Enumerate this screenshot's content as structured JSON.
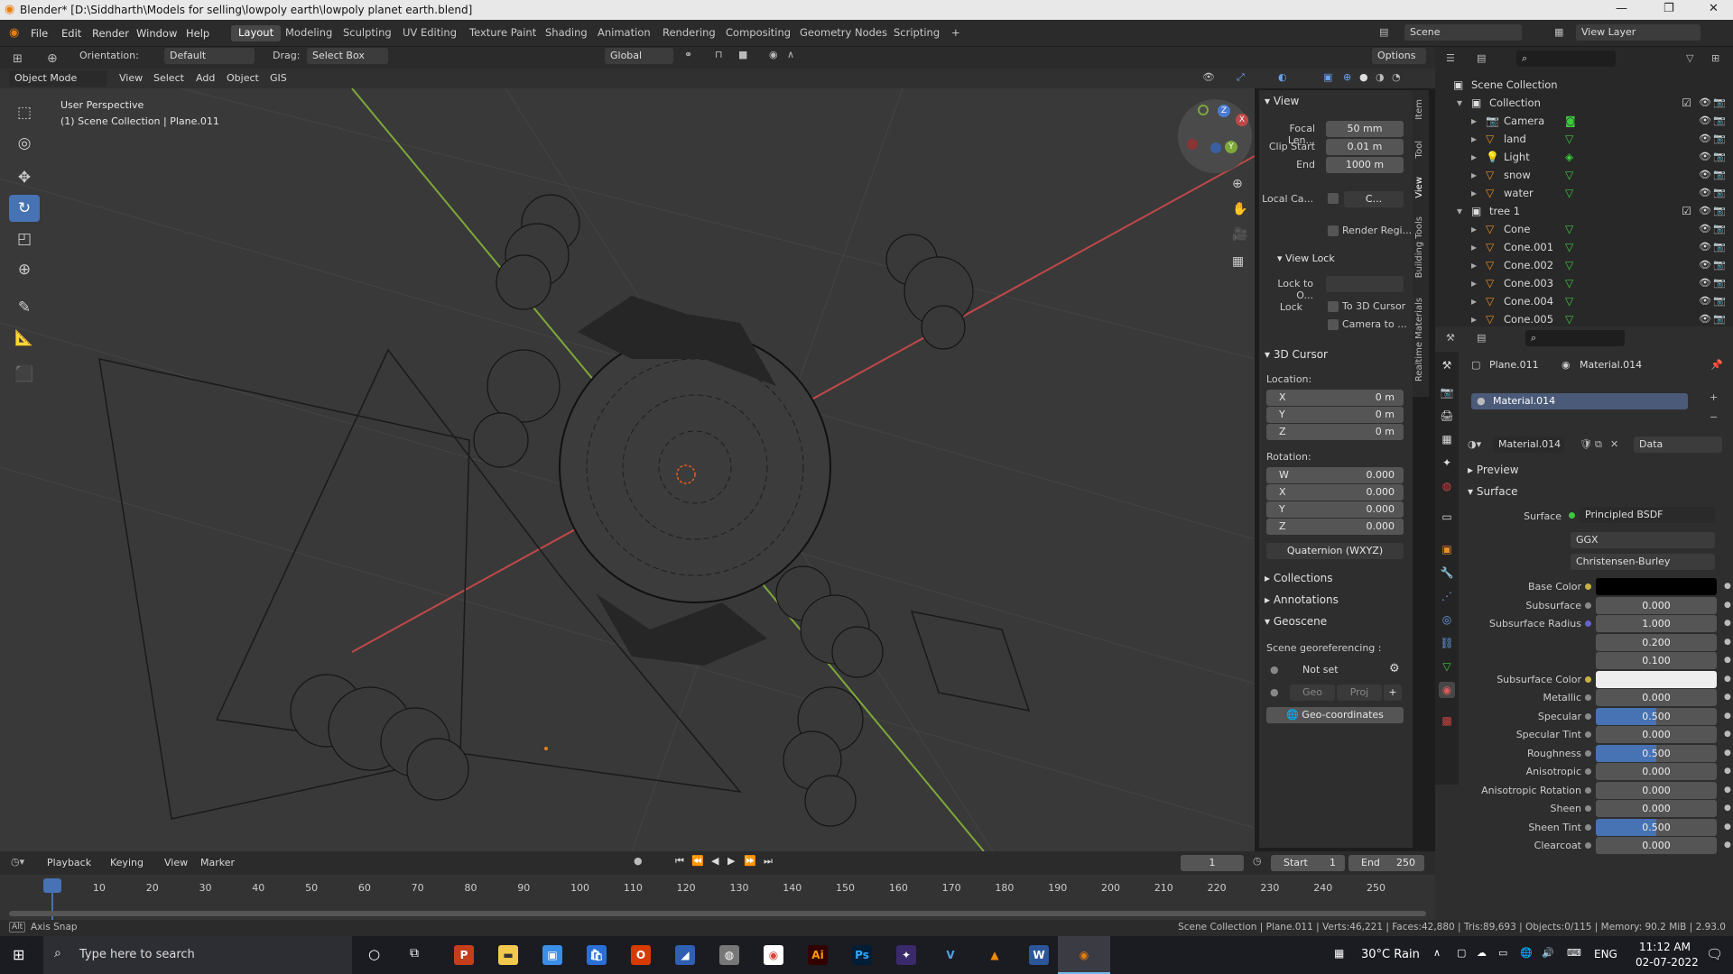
{
  "window": {
    "title": "Blender* [D:\\Siddharth\\Models for selling\\lowpoly earth\\lowpoly planet earth.blend]"
  },
  "menus": [
    "File",
    "Edit",
    "Render",
    "Window",
    "Help"
  ],
  "workspaces": [
    "Layout",
    "Modeling",
    "Sculpting",
    "UV Editing",
    "Texture Paint",
    "Shading",
    "Animation",
    "Rendering",
    "Compositing",
    "Geometry Nodes",
    "Scripting"
  ],
  "scene": {
    "name": "Scene",
    "view_layer": "View Layer"
  },
  "header3d": {
    "orientation_label": "Orientation:",
    "orientation_value": "Default",
    "drag_label": "Drag:",
    "drag_value": "Select Box",
    "transform": "Global",
    "options": "Options"
  },
  "subheader": {
    "mode": "Object Mode",
    "items": [
      "View",
      "Select",
      "Add",
      "Object",
      "GIS"
    ]
  },
  "viewport": {
    "perspective": "User Perspective",
    "collection_info": "(1) Scene Collection | Plane.011"
  },
  "npanel": {
    "tabs": [
      "Item",
      "Tool",
      "View",
      "Building Tools",
      "Realtime Materials"
    ],
    "view_section": "View",
    "focal_label": "Focal Len...",
    "focal_value": "50 mm",
    "clip_start_label": "Clip Start",
    "clip_start_value": "0.01 m",
    "end_label": "End",
    "end_value": "1000 m",
    "local_cam_label": "Local Ca...",
    "local_cam_value": "C...",
    "render_region": "Render Regi...",
    "view_lock": "View Lock",
    "lock_to_label": "Lock to O...",
    "lock_label": "Lock",
    "to_3d_cursor": "To 3D Cursor",
    "camera_to": "Camera to ...",
    "cursor_section": "3D Cursor",
    "location_label": "Location:",
    "loc_x": "0 m",
    "loc_y": "0 m",
    "loc_z": "0 m",
    "rotation_label": "Rotation:",
    "rot_w": "0.000",
    "rot_x": "0.000",
    "rot_y": "0.000",
    "rot_z": "0.000",
    "rotation_mode": "Quaternion (WXYZ)",
    "collections": "Collections",
    "annotations": "Annotations",
    "geoscene": "Geoscene",
    "georef_label": "Scene georeferencing :",
    "not_set": "Not set",
    "geo_btn": "Geo",
    "proj_btn": "Proj",
    "geo_coords": "Geo-coordinates"
  },
  "outliner": {
    "root": "Scene Collection",
    "rows": [
      {
        "name": "Collection",
        "indent": 0,
        "kind": "collection"
      },
      {
        "name": "Camera",
        "indent": 1,
        "kind": "camera"
      },
      {
        "name": "land",
        "indent": 1,
        "kind": "mesh"
      },
      {
        "name": "Light",
        "indent": 1,
        "kind": "light"
      },
      {
        "name": "snow",
        "indent": 1,
        "kind": "mesh"
      },
      {
        "name": "water",
        "indent": 1,
        "kind": "mesh"
      },
      {
        "name": "tree 1",
        "indent": 0,
        "kind": "collection"
      },
      {
        "name": "Cone",
        "indent": 1,
        "kind": "mesh"
      },
      {
        "name": "Cone.001",
        "indent": 1,
        "kind": "mesh"
      },
      {
        "name": "Cone.002",
        "indent": 1,
        "kind": "mesh"
      },
      {
        "name": "Cone.003",
        "indent": 1,
        "kind": "mesh"
      },
      {
        "name": "Cone.004",
        "indent": 1,
        "kind": "mesh"
      },
      {
        "name": "Cone.005",
        "indent": 1,
        "kind": "mesh"
      }
    ]
  },
  "properties": {
    "object": "Plane.011",
    "material": "Material.014",
    "slot": "Material.014",
    "data_link": "Data",
    "preview": "Preview",
    "surface_section": "Surface",
    "surface_label": "Surface",
    "surface_value": "Principled BSDF",
    "distribution": "GGX",
    "subsurface_method": "Christensen-Burley",
    "rows": [
      {
        "label": "Base Color",
        "value": "",
        "kind": "black",
        "dot": "#c7b13f"
      },
      {
        "label": "Subsurface",
        "value": "0.000",
        "kind": "num",
        "dot": "#8a8a8a"
      },
      {
        "label": "Subsurface Radius",
        "value": "1.000",
        "kind": "num",
        "dot": "#6363c7"
      },
      {
        "label": "",
        "value": "0.200",
        "kind": "num",
        "dot": ""
      },
      {
        "label": "",
        "value": "0.100",
        "kind": "num",
        "dot": ""
      },
      {
        "label": "Subsurface Color",
        "value": "",
        "kind": "white",
        "dot": "#c7b13f"
      },
      {
        "label": "Metallic",
        "value": "0.000",
        "kind": "num",
        "dot": "#8a8a8a"
      },
      {
        "label": "Specular",
        "value": "0.500",
        "kind": "half",
        "dot": "#8a8a8a"
      },
      {
        "label": "Specular Tint",
        "value": "0.000",
        "kind": "num",
        "dot": "#8a8a8a"
      },
      {
        "label": "Roughness",
        "value": "0.500",
        "kind": "half",
        "dot": "#8a8a8a"
      },
      {
        "label": "Anisotropic",
        "value": "0.000",
        "kind": "num",
        "dot": "#8a8a8a"
      },
      {
        "label": "Anisotropic Rotation",
        "value": "0.000",
        "kind": "num",
        "dot": "#8a8a8a"
      },
      {
        "label": "Sheen",
        "value": "0.000",
        "kind": "num",
        "dot": "#8a8a8a"
      },
      {
        "label": "Sheen Tint",
        "value": "0.500",
        "kind": "half",
        "dot": "#8a8a8a"
      },
      {
        "label": "Clearcoat",
        "value": "0.000",
        "kind": "num",
        "dot": "#8a8a8a"
      }
    ]
  },
  "timeline": {
    "menus": [
      "Playback",
      "Keying",
      "View",
      "Marker"
    ],
    "current_frame": "1",
    "start_label": "Start",
    "start": "1",
    "end_label": "End",
    "end": "250",
    "ticks": [
      "1",
      "10",
      "20",
      "30",
      "40",
      "50",
      "60",
      "70",
      "80",
      "90",
      "100",
      "110",
      "120",
      "130",
      "140",
      "150",
      "160",
      "170",
      "180",
      "190",
      "200",
      "210",
      "220",
      "230",
      "240",
      "250"
    ]
  },
  "statusbar": {
    "left": "Axis Snap",
    "right": "Scene Collection | Plane.011 | Verts:46,221 | Faces:42,880 | Tris:89,693 | Objects:0/115 | Memory: 90.2 MiB | 2.93.0"
  },
  "taskbar": {
    "search_placeholder": "Type here to search",
    "weather": "30°C  Rain",
    "lang": "ENG",
    "time": "11:12 AM",
    "date": "02-07-2022"
  },
  "colors": {
    "accent": "#4772b3",
    "x_axis": "#c04848",
    "y_axis": "#7ea83a",
    "z_axis": "#4a7bd0"
  }
}
